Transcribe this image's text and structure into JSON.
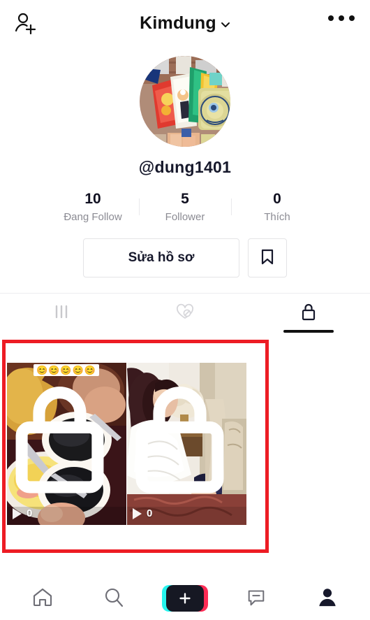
{
  "header": {
    "title": "Kimdung",
    "chevron_icon": "chevron-down-icon",
    "add_friend_icon": "add-friend-icon",
    "more_icon": "more-options-icon"
  },
  "profile": {
    "avatar_icon": "profile-avatar",
    "handle": "@dung1401"
  },
  "stats": [
    {
      "value": "10",
      "label": "Đang Follow"
    },
    {
      "value": "5",
      "label": "Follower"
    },
    {
      "value": "0",
      "label": "Thích"
    }
  ],
  "actions": {
    "edit_profile_label": "Sửa hồ sơ",
    "bookmark_icon": "bookmark-icon"
  },
  "tabs": [
    {
      "name": "posts",
      "icon": "grid-posts-icon",
      "active": false
    },
    {
      "name": "liked",
      "icon": "heart-hidden-icon",
      "active": false
    },
    {
      "name": "private",
      "icon": "lock-icon",
      "active": true
    }
  ],
  "videos": [
    {
      "play_count": "0",
      "lock_icon": "lock-icon",
      "sticker": "😊😊😊😊😊"
    },
    {
      "play_count": "0",
      "lock_icon": "lock-icon",
      "sticker": ""
    }
  ],
  "annotation": {
    "shape": "rectangle",
    "color": "#ed1c24"
  },
  "bottom_nav": [
    {
      "name": "home",
      "icon": "home-icon",
      "active": false
    },
    {
      "name": "discover",
      "icon": "search-icon",
      "active": false
    },
    {
      "name": "create",
      "icon": "plus-icon",
      "active": false
    },
    {
      "name": "inbox",
      "icon": "message-icon",
      "active": false
    },
    {
      "name": "profile",
      "icon": "person-filled-icon",
      "active": true
    }
  ],
  "colors": {
    "accent_cyan": "#25f4ee",
    "accent_pink": "#fe2c55",
    "text_primary": "#16182b",
    "text_muted": "#8b8b93",
    "annotation_red": "#ed1c24"
  }
}
